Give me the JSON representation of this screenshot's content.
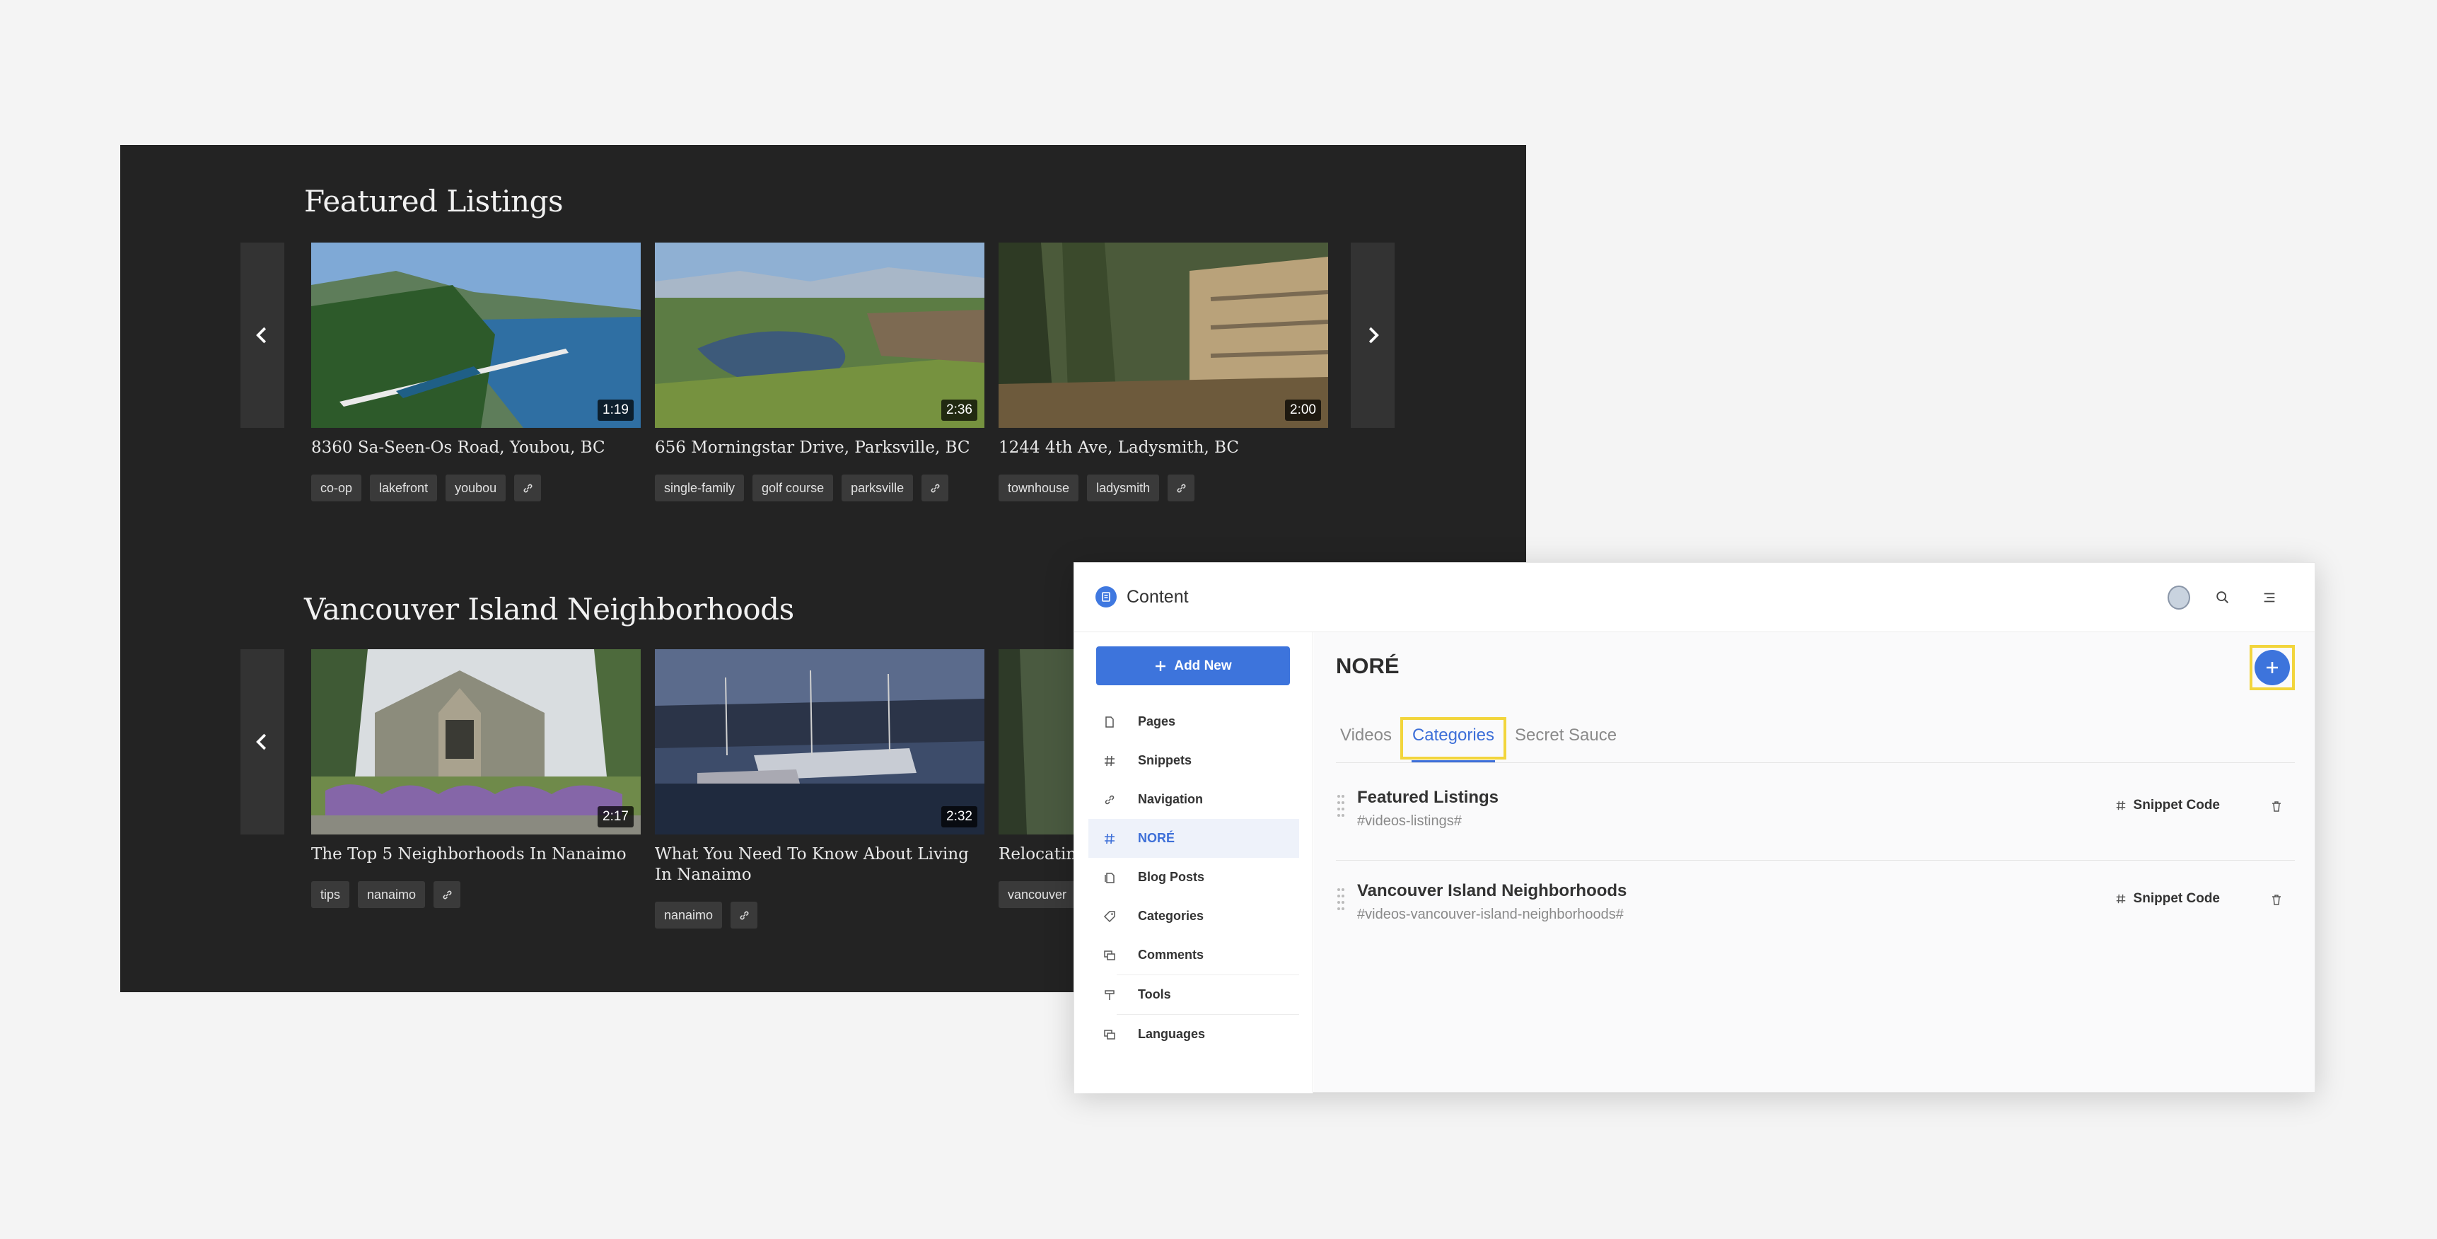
{
  "site": {
    "sections": [
      {
        "title": "Featured Listings",
        "cards": [
          {
            "title": "8360 Sa-Seen-Os Road, Youbou, BC",
            "duration": "1:19",
            "tags": [
              "co-op",
              "lakefront",
              "youbou"
            ]
          },
          {
            "title": "656 Morningstar Drive, Parksville, BC",
            "duration": "2:36",
            "tags": [
              "single-family",
              "golf course",
              "parksville"
            ]
          },
          {
            "title": "1244 4th Ave, Ladysmith, BC",
            "duration": "2:00",
            "tags": [
              "townhouse",
              "ladysmith"
            ]
          }
        ]
      },
      {
        "title": "Vancouver Island Neighborhoods",
        "cards": [
          {
            "title": "The Top 5 Neighborhoods In Nanaimo",
            "duration": "2:17",
            "tags": [
              "tips",
              "nanaimo"
            ]
          },
          {
            "title": "What You Need To Know About Living In Nanaimo",
            "duration": "2:32",
            "tags": [
              "nanaimo"
            ]
          },
          {
            "title": "Relocating",
            "tags": [
              "vancouver"
            ]
          }
        ]
      }
    ]
  },
  "cms": {
    "app_title": "Content",
    "add_new_label": "Add New",
    "nav": [
      {
        "label": "Pages",
        "icon": "page-icon"
      },
      {
        "label": "Snippets",
        "icon": "hash-icon"
      },
      {
        "label": "Navigation",
        "icon": "link-icon"
      },
      {
        "label": "NORÉ",
        "icon": "hash-icon",
        "active": true
      },
      {
        "label": "Blog Posts",
        "icon": "blog-icon"
      },
      {
        "label": "Categories",
        "icon": "tag-icon"
      },
      {
        "label": "Comments",
        "icon": "comments-icon"
      },
      {
        "label": "Tools",
        "icon": "tools-icon"
      },
      {
        "label": "Languages",
        "icon": "languages-icon"
      }
    ],
    "page_heading": "NORÉ",
    "tabs": [
      {
        "label": "Videos"
      },
      {
        "label": "Categories",
        "active": true
      },
      {
        "label": "Secret Sauce"
      }
    ],
    "rows": [
      {
        "name": "Featured Listings",
        "code": "#videos-listings#",
        "action": "Snippet Code"
      },
      {
        "name": "Vancouver Island Neighborhoods",
        "code": "#videos-vancouver-island-neighborhoods#",
        "action": "Snippet Code"
      }
    ],
    "colors": {
      "accent": "#3d74dc",
      "highlight": "#f2d53c"
    }
  }
}
